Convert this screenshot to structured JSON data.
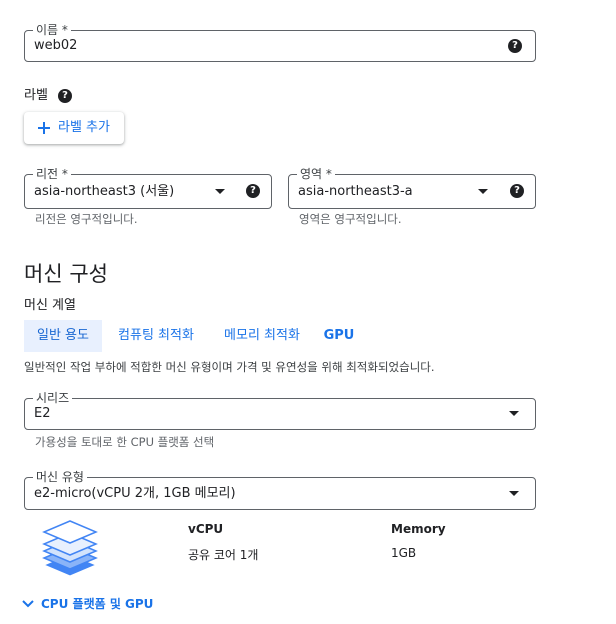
{
  "name_field": {
    "label": "이름 *",
    "value": "web02"
  },
  "labels": {
    "heading": "라벨",
    "add_button": "라벨 추가"
  },
  "region": {
    "label": "리전 *",
    "value": "asia-northeast3 (서울)",
    "hint": "리전은 영구적입니다."
  },
  "zone": {
    "label": "영역 *",
    "value": "asia-northeast3-a",
    "hint": "영역은 영구적입니다."
  },
  "machine_config": {
    "title": "머신 구성",
    "family_label": "머신 계열",
    "tabs": [
      "일반 용도",
      "컴퓨팅 최적화",
      "메모리 최적화",
      "GPU"
    ],
    "selected_tab": 0,
    "tab_description": "일반적인 작업 부하에 적합한 머신 유형이며 가격 및 유연성을 위해 최적화되었습니다."
  },
  "series": {
    "label": "시리즈",
    "value": "E2",
    "hint": "가용성을 토대로 한 CPU 플랫폼 선택"
  },
  "machine_type": {
    "label": "머신 유형",
    "value": "e2-micro(vCPU 2개, 1GB 메모리)"
  },
  "specs": {
    "vcpu_header": "vCPU",
    "memory_header": "Memory",
    "vcpu_value": "공유 코어 1개",
    "memory_value": "1GB"
  },
  "cpu_platform": {
    "label": "CPU 플랫폼 및 GPU"
  },
  "colors": {
    "accent": "#1a73e8",
    "selected_tab_bg": "#e8f0fe",
    "border": "#5f6368"
  },
  "icons": {
    "help": "help-circle-icon",
    "add": "plus-icon",
    "dropdown": "caret-down-icon",
    "stack": "machine-layers-icon",
    "expand": "chevron-down-icon"
  }
}
